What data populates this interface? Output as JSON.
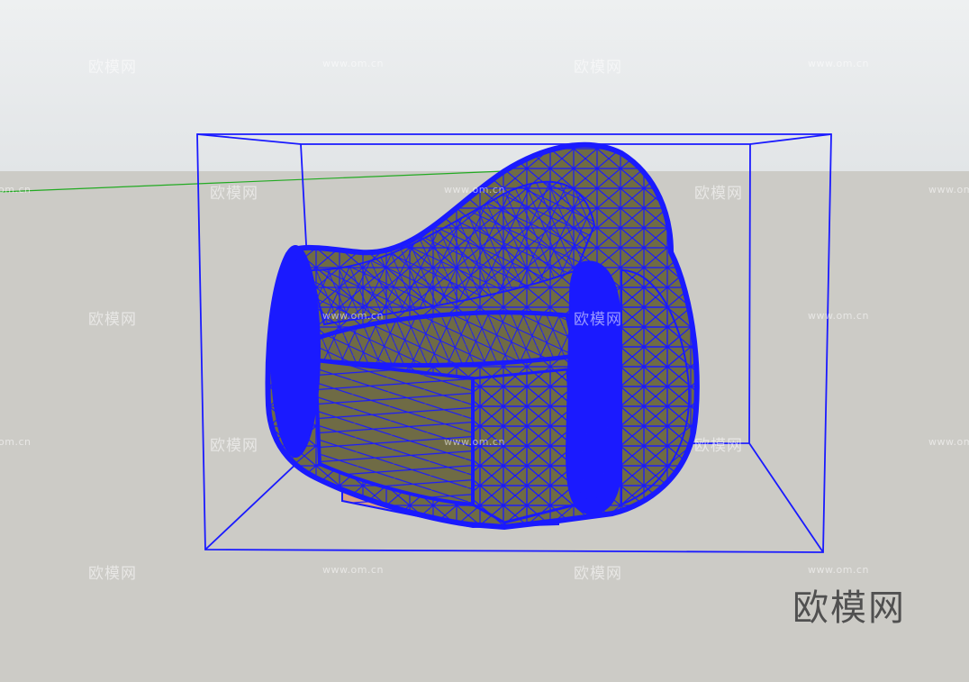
{
  "scene": {
    "sky_color": "#e6e8ea",
    "ground_color": "#cccbc6",
    "wireframe_color": "#1a1aff",
    "model_fill_color": "#6f6b45",
    "base_color": "#d9a080",
    "axis_color": "#00aa00"
  },
  "watermarks": {
    "brand": "欧模网",
    "url": "www.om.cn",
    "url_partial": "om.cn",
    "url_clipped": "www.om"
  },
  "logo": {
    "text": "欧模网",
    "icon": "om-logo"
  }
}
